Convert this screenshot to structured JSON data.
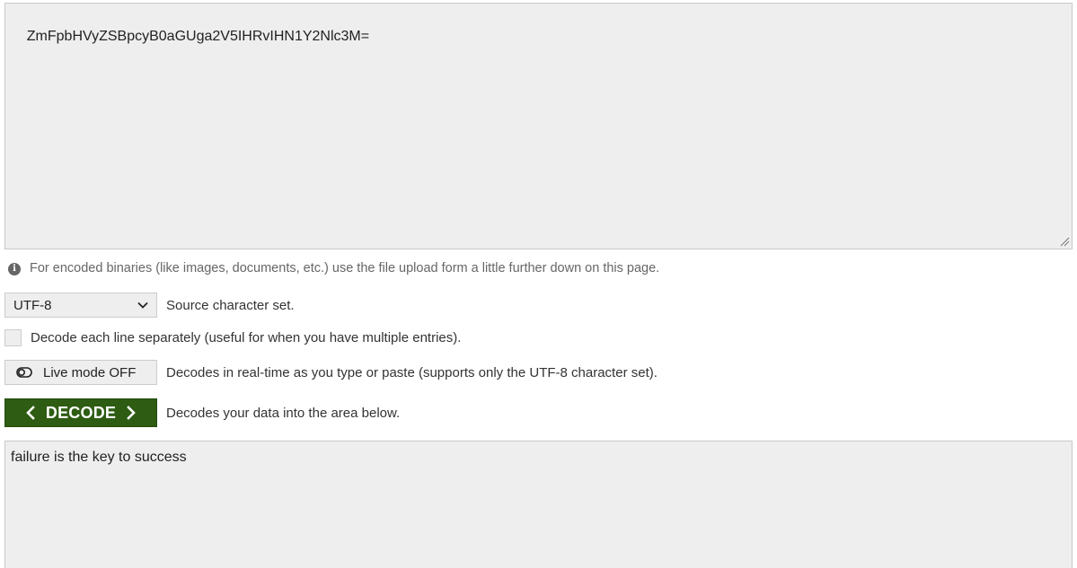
{
  "input": {
    "value": "ZmFpbHVyZSBpcyB0aGUga2V5IHRvIHN1Y2Nlc3M="
  },
  "info": {
    "text": "For encoded binaries (like images, documents, etc.) use the file upload form a little further down on this page.",
    "icon": "info-icon"
  },
  "charset": {
    "selected": "UTF-8",
    "label": "Source character set."
  },
  "line_option": {
    "checked": false,
    "label": "Decode each line separately (useful for when you have multiple entries)."
  },
  "live_mode": {
    "button_label": "Live mode OFF",
    "description": "Decodes in real-time as you type or paste (supports only the UTF-8 character set).",
    "icon": "toggle-off-icon"
  },
  "decode": {
    "button_label": "DECODE",
    "description": "Decodes your data into the area below.",
    "button_color": "#2d5c12"
  },
  "output": {
    "value": "failure is the key to success"
  }
}
